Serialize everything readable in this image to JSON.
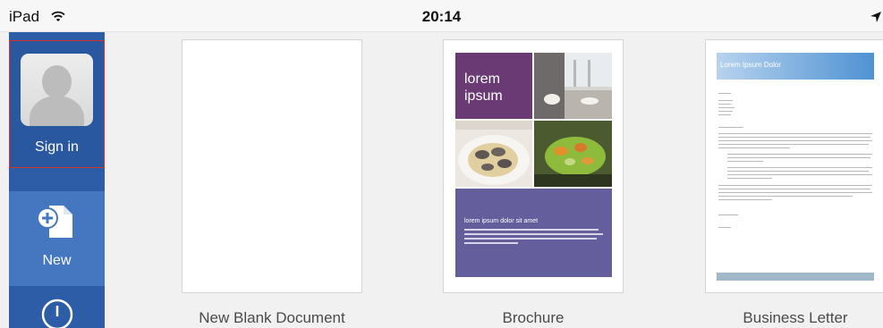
{
  "status_bar": {
    "device": "iPad",
    "time": "20:14",
    "icons": [
      "wifi-icon",
      "location-arrow-icon"
    ]
  },
  "sidebar": {
    "sign_in": {
      "label": "Sign in",
      "icon": "user-avatar-icon"
    },
    "new": {
      "label": "New",
      "icon": "new-document-icon"
    },
    "open": {
      "icon": "open-icon"
    }
  },
  "templates": [
    {
      "label": "New Blank Document"
    },
    {
      "label": "Brochure",
      "preview": {
        "heading": "lorem ipsum",
        "footer_title": "lorem ipsum dolor sit amet"
      }
    },
    {
      "label": "Business Letter",
      "preview": {
        "header": "Lorem Ipsum Dolor"
      }
    }
  ],
  "colors": {
    "sidebar": "#2d5da6",
    "sidebar_active": "#4576c0",
    "selection_border": "#d3332f",
    "brochure_purple": "#693a74",
    "brochure_violet": "#655e9c",
    "letter_header": "#4f92d3"
  }
}
